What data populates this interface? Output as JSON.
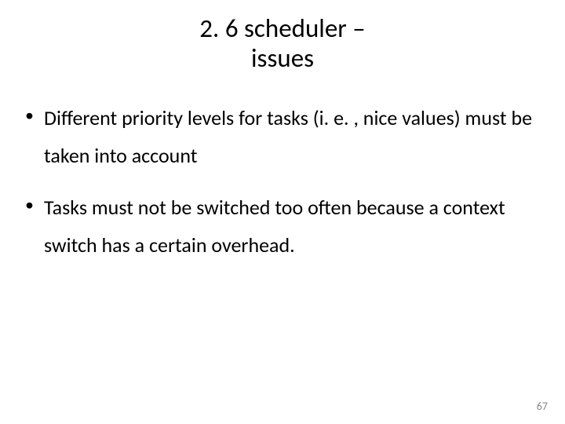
{
  "title_line1": "2. 6 scheduler –",
  "title_line2": "issues",
  "bullets": [
    "Different priority levels for tasks (i. e. , nice values) must be taken into account",
    "Tasks must not be switched too often because a context switch has a certain overhead."
  ],
  "page_number": "67"
}
